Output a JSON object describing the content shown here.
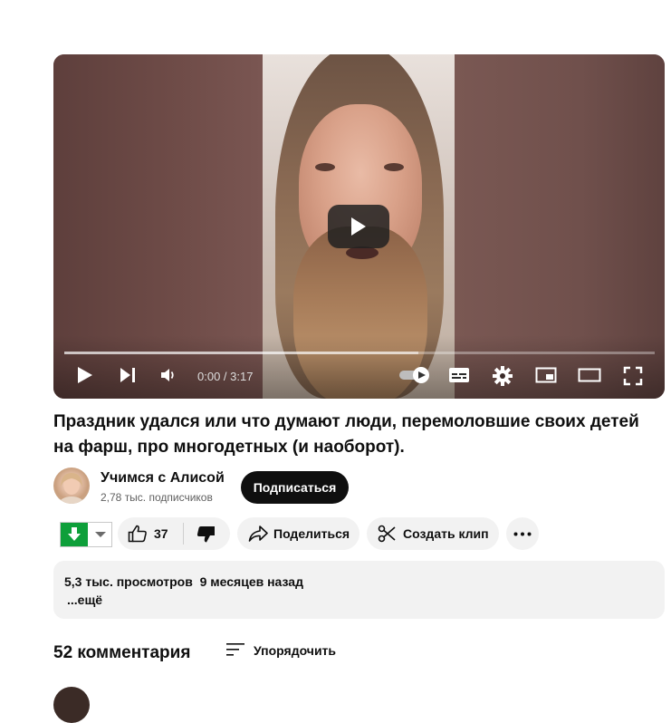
{
  "player": {
    "time_current": "0:00",
    "time_separator": " / ",
    "time_total": "3:17",
    "progress_loaded_fraction": 0.6,
    "icons": [
      "play-icon",
      "next-icon",
      "volume-icon",
      "autoplay-toggle-icon",
      "subtitles-icon",
      "settings-icon",
      "miniplayer-icon",
      "theater-icon",
      "fullscreen-icon"
    ]
  },
  "video": {
    "title": "Праздник удался или что думают люди, перемоловшие своих детей на фарш, про многодетных (и наоборот)."
  },
  "channel": {
    "name": "Учимся с Алисой",
    "subscribers": "2,78 тыс. подписчиков",
    "subscribe_label": "Подписаться"
  },
  "actions": {
    "like_count": "37",
    "share_label": "Поделиться",
    "clip_label": "Создать клип"
  },
  "description": {
    "views": "5,3 тыс. просмотров",
    "date": "9 месяцев назад",
    "more_label": "...ещё"
  },
  "comments": {
    "count_label": "52 комментария",
    "sort_label": "Упорядочить"
  },
  "colors": {
    "download_green": "#0e9f3a",
    "subscribe_bg": "#0f0f0f",
    "chip_bg": "#f2f2f2"
  }
}
